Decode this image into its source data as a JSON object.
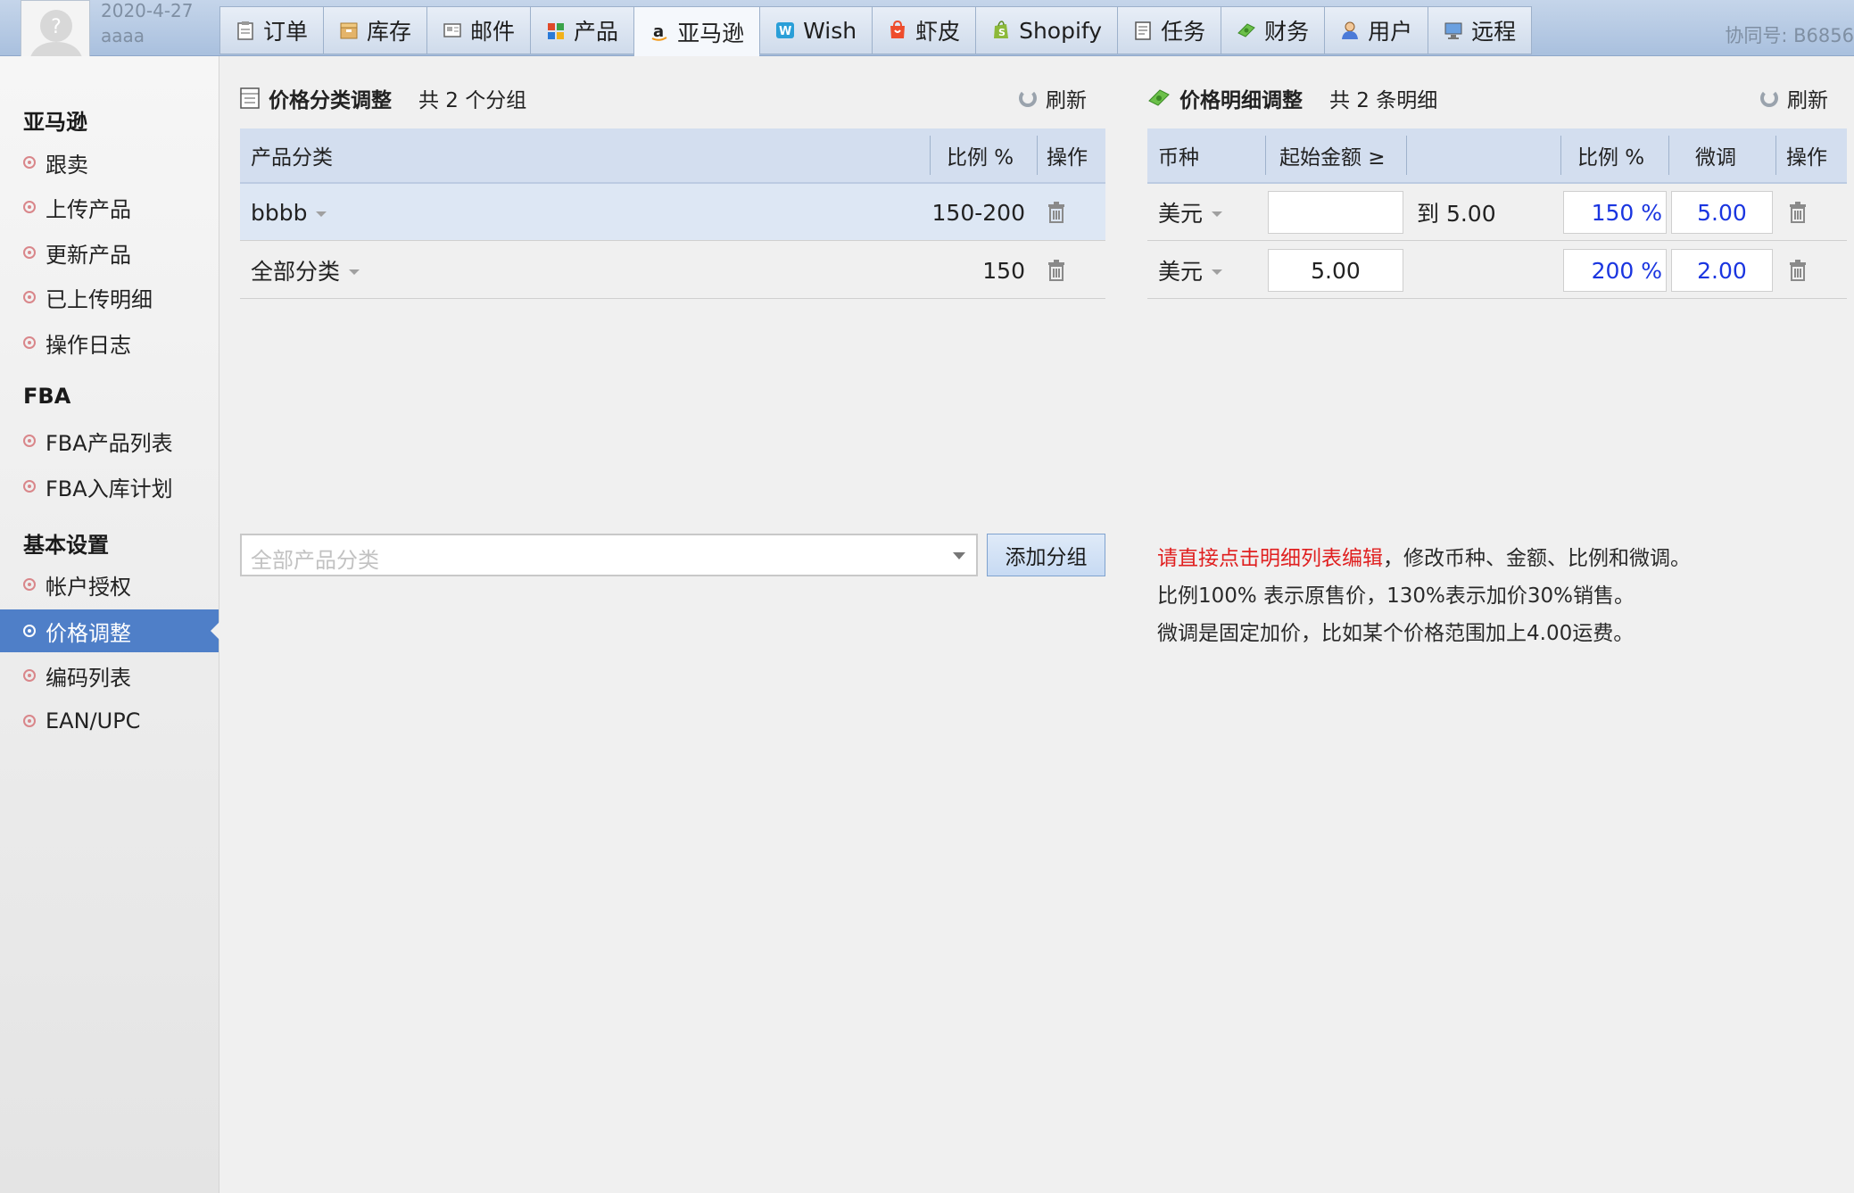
{
  "header": {
    "date": "2020-4-27",
    "username": "aaaa",
    "collab_label": "协同号: B6856",
    "tabs": [
      {
        "label": "订单",
        "icon": "clipboard-icon"
      },
      {
        "label": "库存",
        "icon": "box-icon"
      },
      {
        "label": "邮件",
        "icon": "mail-icon"
      },
      {
        "label": "产品",
        "icon": "grid-icon"
      },
      {
        "label": "亚马逊",
        "icon": "amazon-icon",
        "active": true
      },
      {
        "label": "Wish",
        "icon": "wish-icon"
      },
      {
        "label": "虾皮",
        "icon": "shopee-icon"
      },
      {
        "label": "Shopify",
        "icon": "shopify-icon"
      },
      {
        "label": "任务",
        "icon": "task-icon"
      },
      {
        "label": "财务",
        "icon": "money-icon"
      },
      {
        "label": "用户",
        "icon": "user-icon"
      },
      {
        "label": "远程",
        "icon": "monitor-icon"
      }
    ]
  },
  "sidebar": {
    "groups": [
      {
        "title": "亚马逊",
        "items": [
          "跟卖",
          "上传产品",
          "更新产品",
          "已上传明细",
          "操作日志"
        ]
      },
      {
        "title": "FBA",
        "items": [
          "FBA产品列表",
          "FBA入库计划"
        ]
      },
      {
        "title": "基本设置",
        "items": [
          "帐户授权",
          "价格调整",
          "编码列表",
          "EAN/UPC"
        ]
      }
    ],
    "active_item": "价格调整"
  },
  "left_panel": {
    "title": "价格分类调整",
    "count": "共 2 个分组",
    "refresh": "刷新",
    "columns": [
      "产品分类",
      "比例 %",
      "操作"
    ],
    "rows": [
      {
        "category": "bbbb",
        "ratio": "150-200"
      },
      {
        "category": "全部分类",
        "ratio": "150"
      }
    ],
    "select_placeholder": "全部产品分类",
    "add_button": "添加分组"
  },
  "right_panel": {
    "title": "价格明细调整",
    "count": "共 2 条明细",
    "refresh": "刷新",
    "columns": [
      "币种",
      "起始金额 ≥",
      "",
      "比例 %",
      "微调",
      "操作"
    ],
    "rows": [
      {
        "currency": "美元",
        "start": "",
        "to": "到 5.00",
        "ratio": "150 %",
        "adjust": "5.00"
      },
      {
        "currency": "美元",
        "start": "5.00",
        "to": "",
        "ratio": "200 %",
        "adjust": "2.00"
      }
    ],
    "help": {
      "line1_red": "请直接点击明细列表编辑",
      "line1_rest": "，修改币种、金额、比例和微调。",
      "line2": "比例100% 表示原售价，130%表示加价30%销售。",
      "line3": "微调是固定加价，比如某个价格范围加上4.00运费。"
    }
  },
  "colors": {
    "accent": "#4f7fc8",
    "header_bg": "#d3deef",
    "highlight_row": "#dde7f4",
    "help_red": "#e02020",
    "value_blue": "#1a35e0"
  }
}
